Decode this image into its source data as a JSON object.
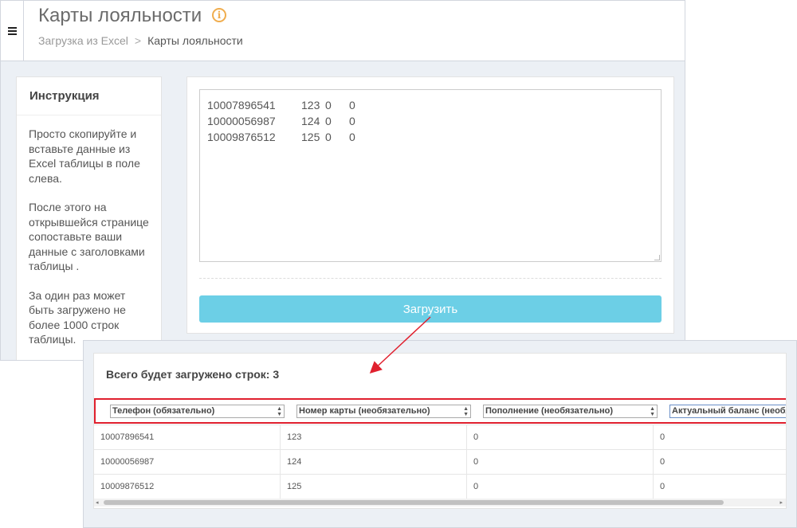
{
  "header": {
    "title": "Карты лояльности",
    "breadcrumb": {
      "parent": "Загрузка из Excel",
      "separator": ">",
      "current": "Карты лояльности"
    }
  },
  "icons": {
    "menu": "hamburger-icon",
    "info": "info-icon",
    "info_glyph": "i"
  },
  "colors": {
    "upload_button": "#6ccfe6",
    "highlight": "#e0202e",
    "arrow": "#e0202e",
    "info": "#f0ad4e"
  },
  "instruction": {
    "title": "Инструкция",
    "paragraphs": [
      "Просто скопируйте и вставьте данные из Excel таблицы в поле слева.",
      "После этого на открывшейся странице сопоставьте ваши данные с заголовками таблицы .",
      "За один раз может быть загружено не более 1000 строк таблицы."
    ]
  },
  "paste_area": {
    "rows": [
      [
        "10007896541",
        "123",
        "0",
        "0"
      ],
      [
        "10000056987",
        "124",
        "0",
        "0"
      ],
      [
        "10009876512",
        "125",
        "0",
        "0"
      ]
    ]
  },
  "upload_button": "Загрузить",
  "preview": {
    "total_label": "Всего будет загружено строк: 3",
    "columns": [
      "Телефон (обязательно)",
      "Номер карты (необязательно)",
      "Пополнение (необязательно)",
      "Актуальный баланс (необя"
    ],
    "rows": [
      [
        "10007896541",
        "123",
        "0",
        "0"
      ],
      [
        "10000056987",
        "124",
        "0",
        "0"
      ],
      [
        "10009876512",
        "125",
        "0",
        "0"
      ]
    ],
    "scroll_left": "◂",
    "scroll_right": "▸"
  }
}
